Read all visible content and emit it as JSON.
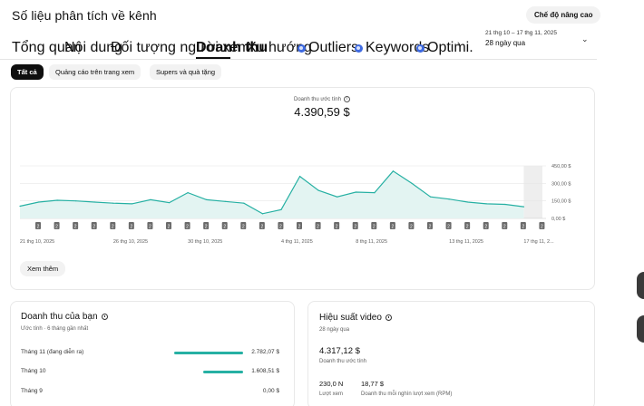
{
  "header": {
    "title": "Số liệu phân tích về kênh",
    "advanced_button": "Chế độ nâng cao",
    "date_range": "21 thg 10 – 17 thg 11, 2025",
    "date_period": "28 ngày qua"
  },
  "tabs": [
    {
      "label": "Tổng quan"
    },
    {
      "label": "Nội dung"
    },
    {
      "label": "Đối tượng người xem"
    },
    {
      "label": "Doanh thu",
      "active": true
    },
    {
      "label": "Xu hướng"
    },
    {
      "label": "Outliers",
      "icon": "plugin-icon"
    },
    {
      "label": "Keywords",
      "icon": "plugin-icon"
    },
    {
      "label": "Optimi.",
      "icon": "plugin-icon"
    }
  ],
  "chips": [
    {
      "label": "Tất cả",
      "active": true
    },
    {
      "label": "Quảng cáo trên trang xem"
    },
    {
      "label": "Supers và quà tặng"
    }
  ],
  "summary": {
    "label": "Doanh thu ước tính",
    "value": "4.390,59 $"
  },
  "chart_data": {
    "type": "area",
    "ylim": [
      0,
      450
    ],
    "yticks": [
      "450,00 $",
      "300,00 $",
      "150,00 $",
      "0,00 $"
    ],
    "ytick_values": [
      450,
      300,
      150,
      0
    ],
    "x_labels": [
      "21 thg 10, 2025",
      "26 thg 10, 2025",
      "30 thg 10, 2025",
      "4 thg 11, 2025",
      "8 thg 11, 2025",
      "13 thg 11, 2025",
      "17 thg 11, 2..."
    ],
    "x_label_indices": [
      0,
      5,
      9,
      14,
      18,
      23,
      27
    ],
    "values": [
      105,
      140,
      155,
      150,
      140,
      130,
      125,
      160,
      135,
      220,
      160,
      145,
      130,
      40,
      75,
      360,
      240,
      185,
      225,
      220,
      405,
      300,
      185,
      165,
      140,
      125,
      120,
      100
    ],
    "marker_label": "2",
    "highlight_last": true,
    "color": "#26b0a3",
    "fill": "#e3f4f2"
  },
  "see_more": "Xem thêm",
  "revenue_card": {
    "title": "Doanh thu của bạn",
    "subtitle": "Ước tính · 6 tháng gần nhất",
    "rows": [
      {
        "label": "Tháng 11 (đang diễn ra)",
        "value": "2.782,07 $",
        "fraction": 1.0
      },
      {
        "label": "Tháng 10",
        "value": "1.608,51 $",
        "fraction": 0.58
      },
      {
        "label": "Tháng 9",
        "value": "0,00 $",
        "fraction": 0
      }
    ]
  },
  "performance_card": {
    "title": "Hiệu suất video",
    "subtitle": "28 ngày qua",
    "revenue_value": "4.317,12 $",
    "revenue_label": "Doanh thu ước tính",
    "views_value": "230,0 N",
    "views_label": "Lượt xem",
    "rpm_value": "18,77 $",
    "rpm_label": "Doanh thu mỗi nghìn lượt xem (RPM)"
  },
  "colors": {
    "accent": "#26b0a3",
    "plugin": "#3e6ae1"
  }
}
